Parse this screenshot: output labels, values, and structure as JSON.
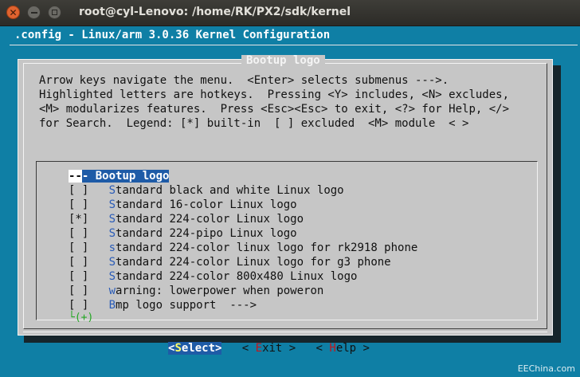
{
  "window": {
    "title": "root@cyl-Lenovo: /home/RK/PX2/sdk/kernel",
    "close_glyph": "✕"
  },
  "config_title": ".config - Linux/arm 3.0.36 Kernel Configuration",
  "dialog": {
    "title": "Bootup logo",
    "help_lines": [
      "Arrow keys navigate the menu.  <Enter> selects submenus --->.",
      "Highlighted letters are hotkeys.  Pressing <Y> includes, <N> excludes,",
      "<M> modularizes features.  Press <Esc><Esc> to exit, <?> for Help, </>",
      "for Search.  Legend: [*] built-in  [ ] excluded  <M> module  < >"
    ]
  },
  "menu": {
    "header": {
      "prefix": "-",
      "mid": "-",
      "dash2": "-",
      "label": " Bootup logo"
    },
    "items": [
      {
        "mark": "[ ]",
        "hot": "S",
        "rest": "tandard black and white Linux logo"
      },
      {
        "mark": "[ ]",
        "hot": "S",
        "rest": "tandard 16-color Linux logo"
      },
      {
        "mark": "[*]",
        "hot": "S",
        "rest": "tandard 224-color Linux logo"
      },
      {
        "mark": "[ ]",
        "hot": "S",
        "rest": "tandard 224-pipo Linux logo"
      },
      {
        "mark": "[ ]",
        "hot": "s",
        "rest": "tandard 224-color linux logo for rk2918 phone"
      },
      {
        "mark": "[ ]",
        "hot": "S",
        "rest": "tandard 224-color Linux logo for g3 phone"
      },
      {
        "mark": "[ ]",
        "hot": "S",
        "rest": "tandard 224-color 800x480 Linux logo"
      },
      {
        "mark": "[ ]",
        "hot": "w",
        "rest": "arning: lowerpower when poweron"
      },
      {
        "mark": "[ ]",
        "hot": "B",
        "rest": "mp logo support  --->"
      }
    ],
    "more_indicator": "└(+)"
  },
  "buttons": {
    "select": {
      "open": "<",
      "hot": "S",
      "rest": "elect",
      "close": ">"
    },
    "exit": {
      "open": "< ",
      "hot": "E",
      "rest": "xit",
      "close": " >"
    },
    "help": {
      "open": "< ",
      "hot": "H",
      "rest": "elp",
      "close": " >"
    }
  },
  "watermark": "EEChina.com"
}
